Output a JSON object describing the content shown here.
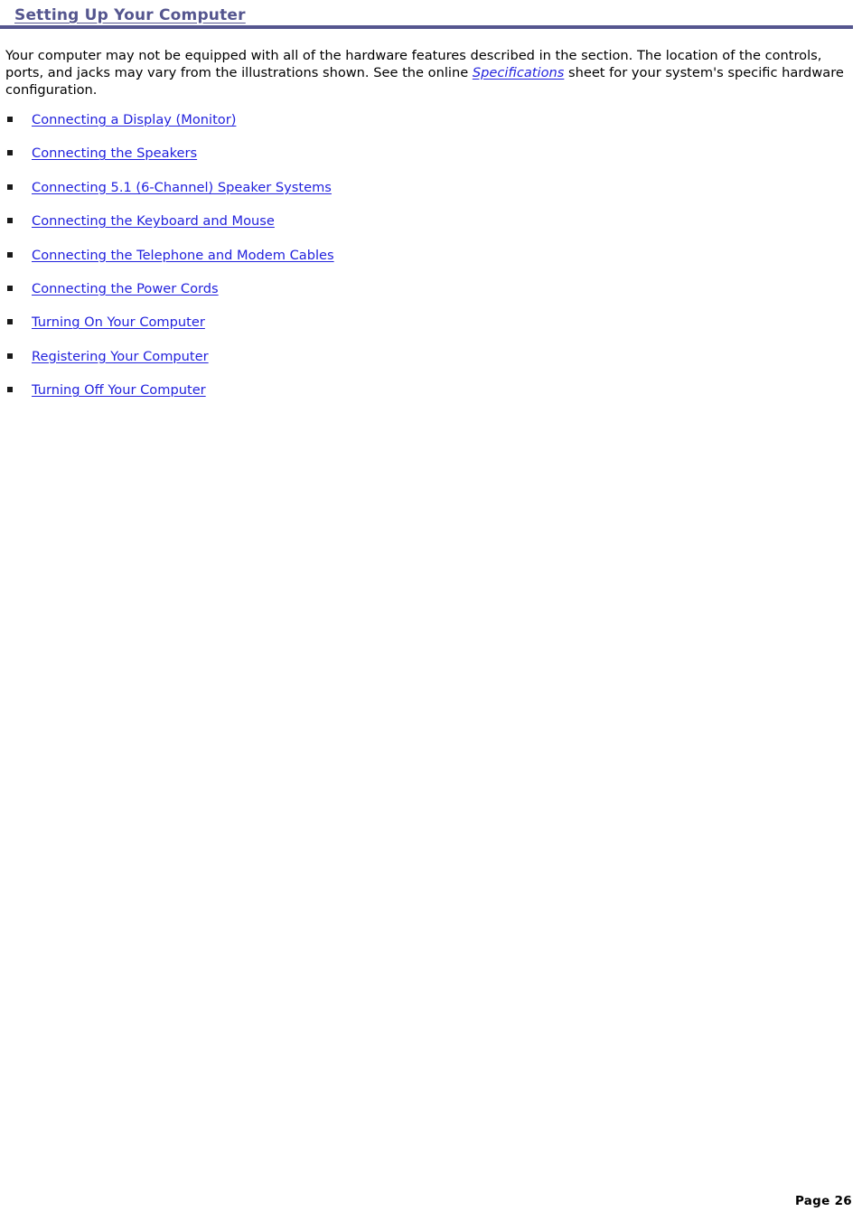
{
  "document": {
    "title": "Setting Up Your Computer"
  },
  "header": {
    "title": "Setting Up Your Computer",
    "rule_color": "#55568f",
    "title_color": "#55568f"
  },
  "intro": {
    "text_before_link": "Your computer may not be equipped with all of the hardware features described in the section. The location of the controls, ports, and jacks may vary from the illustrations shown. See the online ",
    "link_text": "Specifications",
    "text_after_link": " sheet for your system's specific hardware configuration."
  },
  "link_list": {
    "bullet_icon": "square-bullet-icon",
    "link_color": "#2222dd",
    "items": [
      {
        "label": "Connecting a Display (Monitor)"
      },
      {
        "label": "Connecting the Speakers"
      },
      {
        "label": "Connecting 5.1 (6-Channel) Speaker Systems"
      },
      {
        "label": "Connecting the Keyboard and Mouse"
      },
      {
        "label": "Connecting the Telephone and Modem Cables"
      },
      {
        "label": "Connecting the Power Cords"
      },
      {
        "label": "Turning On Your Computer"
      },
      {
        "label": "Registering Your Computer"
      },
      {
        "label": "Turning Off Your Computer"
      }
    ]
  },
  "footer": {
    "page_label": "Page 26"
  }
}
